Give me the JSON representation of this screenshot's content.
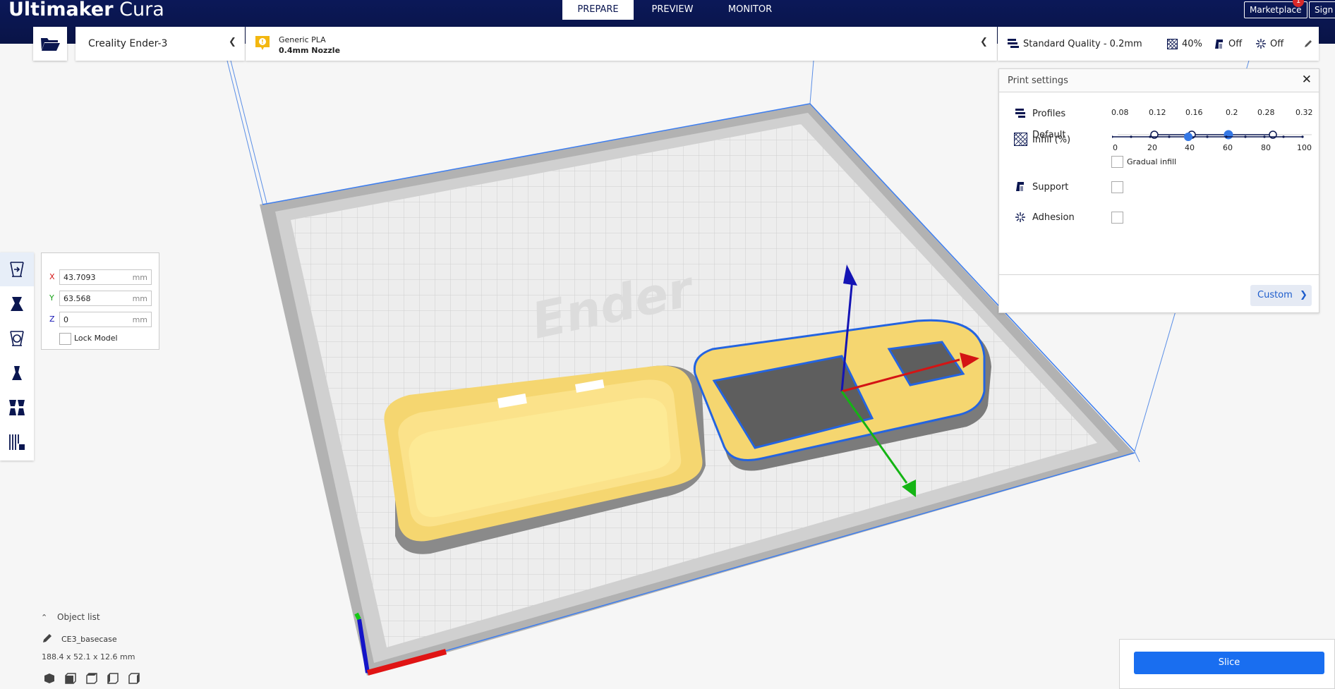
{
  "header": {
    "brand": "Ultimaker",
    "product": "Cura",
    "stages": [
      "PREPARE",
      "PREVIEW",
      "MONITOR"
    ],
    "active_stage": "PREPARE",
    "marketplace_label": "Marketplace",
    "notification_count": "1",
    "signin_label": "Sign in"
  },
  "printer": {
    "name": "Creality Ender-3"
  },
  "material": {
    "name": "Generic PLA",
    "nozzle": "0.4mm Nozzle",
    "warning_icon": "warning-badge-icon"
  },
  "settings_summary": {
    "quality": "Standard Quality - 0.2mm",
    "infill": "40%",
    "support": "Off",
    "adhesion": "Off"
  },
  "print_settings": {
    "title": "Print settings",
    "profiles_label": "Profiles",
    "profile_name": "Default",
    "layer_heights": [
      "0.08",
      "0.12",
      "0.16",
      "0.2",
      "0.28",
      "0.32"
    ],
    "selected_layer_height": "0.2",
    "infill_label": "Infill (%)",
    "infill_ticks": [
      "0",
      "20",
      "40",
      "60",
      "80",
      "100"
    ],
    "infill_value": 40,
    "gradual_infill_label": "Gradual infill",
    "support_label": "Support",
    "adhesion_label": "Adhesion",
    "custom_label": "Custom"
  },
  "move_tool": {
    "x_label": "X",
    "x_value": "43.7093",
    "y_label": "Y",
    "y_value": "63.568",
    "z_label": "Z",
    "z_value": "0",
    "unit": "mm",
    "lock_label": "Lock Model"
  },
  "objects": {
    "list_label": "Object list",
    "name": "CE3_basecase",
    "dimensions": "188.4 x 52.1 x 12.6 mm"
  },
  "slice": {
    "label": "Slice"
  },
  "colors": {
    "header_bg": "#0a1650",
    "accent": "#196ef0",
    "model_yellow": "#f8d96a",
    "axis_x": "#d41414",
    "axis_y": "#14b414",
    "axis_z": "#1414b4"
  }
}
